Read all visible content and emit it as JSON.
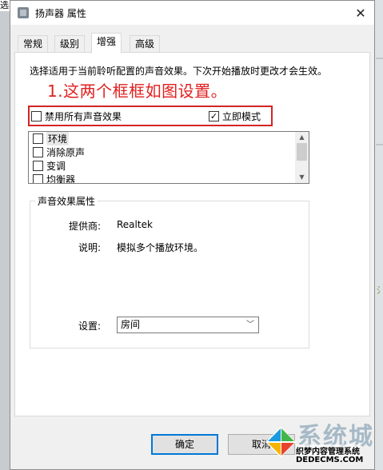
{
  "background": {
    "left_edge_text": "选"
  },
  "window": {
    "title": "扬声器 属性",
    "close_glyph": "✕"
  },
  "tabs": [
    {
      "label": "常规",
      "active": false
    },
    {
      "label": "级别",
      "active": false
    },
    {
      "label": "增强",
      "active": true
    },
    {
      "label": "高级",
      "active": false
    }
  ],
  "enhancements": {
    "description": "选择适用于当前聆听配置的声音效果。下次开始播放时更改才会生效。",
    "annotation": "1.这两个框框如图设置。",
    "disable_all_label": "禁用所有声音效果",
    "disable_all_checked": false,
    "immediate_mode_label": "立即模式",
    "immediate_mode_checked": true,
    "effects": [
      {
        "label": "环境",
        "checked": false
      },
      {
        "label": "消除原声",
        "checked": false
      },
      {
        "label": "变调",
        "checked": false
      },
      {
        "label": "均衡器",
        "checked": false
      }
    ]
  },
  "properties": {
    "group_label": "声音效果属性",
    "provider_label": "提供商:",
    "provider_value": "Realtek",
    "description_label": "说明:",
    "description_value": "模拟多个播放环境。",
    "setting_label": "设置:",
    "setting_value": "房间"
  },
  "buttons": {
    "ok": "确定",
    "cancel": "取消"
  },
  "watermark": {
    "brand": "系统城",
    "line1": "织梦内容管理系统",
    "line2": "DEDECMS.COM"
  },
  "colors": {
    "annotation": "#e02020",
    "highlight_box": "#d32424",
    "focus_blue": "#0078d7"
  }
}
